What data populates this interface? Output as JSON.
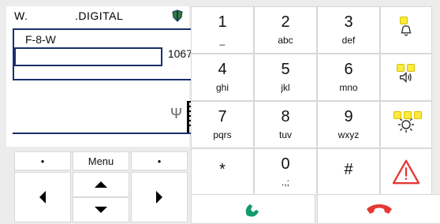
{
  "brand": {
    "left": "W.",
    "right": ".DIGITAL"
  },
  "screen": {
    "line1": "F-8-W",
    "field_value": "",
    "number": "1067"
  },
  "nav": {
    "soft_left": "•",
    "menu": "Menu",
    "soft_right": "•"
  },
  "keys": [
    {
      "main": "1",
      "sub": "_"
    },
    {
      "main": "2",
      "sub": "abc"
    },
    {
      "main": "3",
      "sub": "def"
    },
    {
      "main": "4",
      "sub": "ghi"
    },
    {
      "main": "5",
      "sub": "jkl"
    },
    {
      "main": "6",
      "sub": "mno"
    },
    {
      "main": "7",
      "sub": "pqrs"
    },
    {
      "main": "8",
      "sub": "tuv"
    },
    {
      "main": "9",
      "sub": "wxyz"
    },
    {
      "main": "*",
      "sub": ""
    },
    {
      "main": "0",
      "sub": ".,;"
    },
    {
      "main": "#",
      "sub": ""
    }
  ],
  "colors": {
    "accent": "#1a2f6c",
    "alert_red": "#e53935",
    "call_green": "#129b6b",
    "end_red": "#e53935",
    "yellow": "#ffeb3b"
  },
  "icons": {
    "bell": "bell-icon",
    "speaker": "speaker-icon",
    "light": "light-icon",
    "alert": "alert-icon",
    "call": "call-icon",
    "end": "end-call-icon"
  }
}
